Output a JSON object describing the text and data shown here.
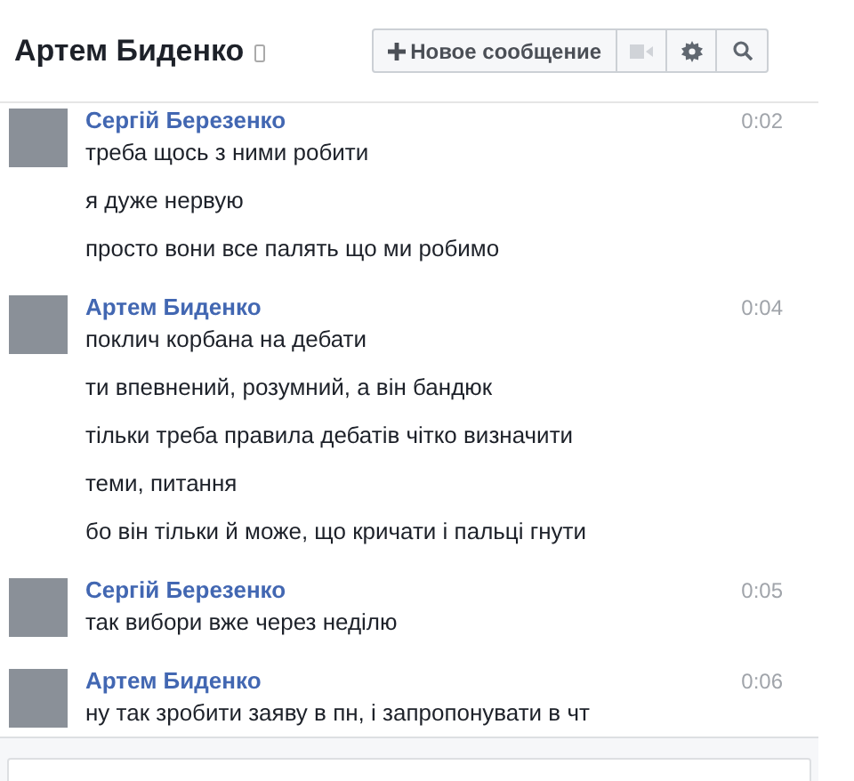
{
  "header": {
    "title": "Артем Биденко",
    "new_message_button": "Новое сообщение"
  },
  "messages": [
    {
      "author": "Сергій Березенко",
      "time": "0:02",
      "lines": [
        "треба щось з ними робити",
        "я дуже нервую",
        "просто вони все палять що ми робимо"
      ]
    },
    {
      "author": "Артем Биденко",
      "time": "0:04",
      "lines": [
        "поклич корбана на дебати",
        "ти впевнений, розумний, а він бандюк",
        "тільки треба правила дебатів чітко визначити",
        "теми, питання",
        "бо він тільки й може, що кричати і пальці гнути"
      ]
    },
    {
      "author": "Сергій Березенко",
      "time": "0:05",
      "lines": [
        "так вибори вже через неділю"
      ]
    },
    {
      "author": "Артем Биденко",
      "time": "0:06",
      "lines": [
        "ну так зробити заяву в пн, і запропонувати в чт"
      ]
    }
  ]
}
